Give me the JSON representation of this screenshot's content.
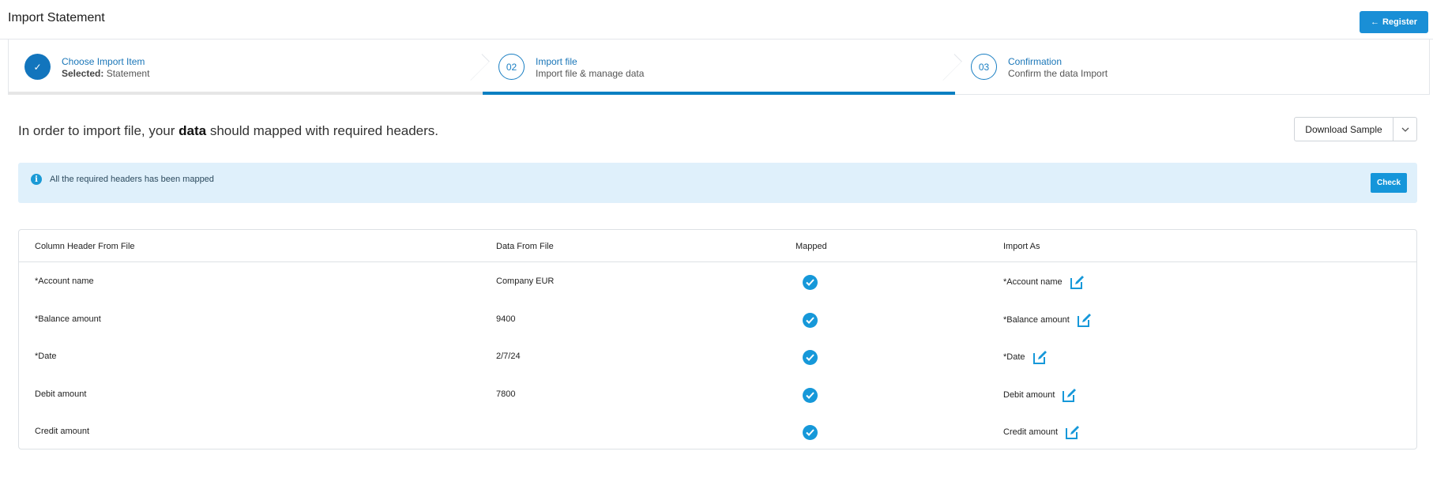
{
  "header": {
    "title": "Import Statement",
    "register_label": "Register",
    "register_icon": "arrow-left-icon"
  },
  "stepper": {
    "steps": [
      {
        "marker": "✓",
        "title": "Choose Import Item",
        "sub_label": "Selected:",
        "sub_value": "Statement",
        "state": "complete"
      },
      {
        "marker": "02",
        "title": "Import file",
        "sub": "Import file & manage data",
        "state": "active"
      },
      {
        "marker": "03",
        "title": "Confirmation",
        "sub": "Confirm the data Import",
        "state": "pending"
      }
    ]
  },
  "intro": {
    "before": "In order to import file, your ",
    "bold": "data",
    "after": " should mapped with required headers."
  },
  "download": {
    "label": "Download Sample",
    "caret_icon": "chevron-down-icon"
  },
  "alert": {
    "icon": "info-icon",
    "text": "All the required headers has been mapped",
    "check_label": "Check"
  },
  "table": {
    "headers": [
      "Column Header From File",
      "Data From File",
      "Mapped",
      "Import As"
    ],
    "rows": [
      {
        "column": "*Account name",
        "data": "Company EUR",
        "mapped": true,
        "import_as": "*Account name"
      },
      {
        "column": "*Balance amount",
        "data": "9400",
        "mapped": true,
        "import_as": "*Balance amount"
      },
      {
        "column": "*Date",
        "data": "2/7/24",
        "mapped": true,
        "import_as": "*Date"
      },
      {
        "column": "Debit amount",
        "data": "7800",
        "mapped": true,
        "import_as": "Debit amount"
      },
      {
        "column": "Credit amount",
        "data": "",
        "mapped": true,
        "import_as": "Credit amount"
      }
    ]
  },
  "colors": {
    "accent": "#1a8fd6",
    "step_active": "#0a7fc2",
    "alert_bg": "#dff0fb"
  }
}
